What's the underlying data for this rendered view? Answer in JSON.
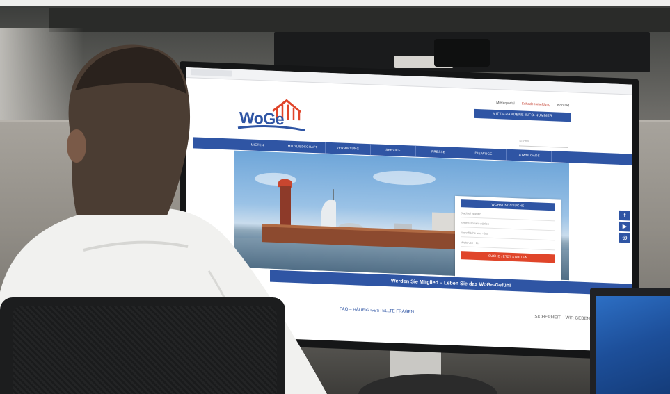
{
  "website": {
    "logo_text": "WoGe",
    "top_links": [
      "Mieterportal",
      "Schadensmeldung",
      "Kontakt"
    ],
    "cta_label": "MITTAG/ANDERE INFO-NUMMER",
    "search_placeholder": "Suche",
    "nav_items": [
      "MIETEN",
      "MITGLIEDSCHAFT",
      "VERMIETUNG",
      "SERVICE",
      "PRESSE",
      "DIE WOGE",
      "DOWNLOADS"
    ],
    "form": {
      "header": "WOHNUNGSSUCHE",
      "fields": [
        "Stadtteil wählen",
        "Zimmeranzahl wählen",
        "Wohnfläche von - bis",
        "Miete von - bis"
      ],
      "submit": "SUCHE JETZT STARTEN"
    },
    "banner": "Werden Sie Mitglied – Leben Sie das WoGe-Gefühl",
    "lower_links": {
      "faq": "FAQ – HÄUFIG GESTELLTE FRAGEN",
      "security": "SICHERHEIT – WIR GEBEN"
    },
    "social": [
      "f",
      "▶",
      "◎"
    ]
  },
  "colors": {
    "brand_blue": "#2f55a4",
    "accent_red": "#e0452a"
  }
}
